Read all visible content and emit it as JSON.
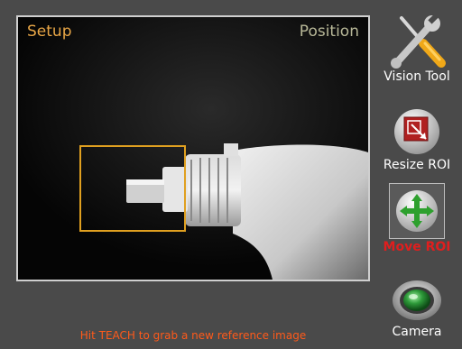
{
  "viewport": {
    "mode_label": "Setup",
    "tool_label": "Position"
  },
  "status": {
    "message": "Hit TEACH to grab a new reference image"
  },
  "tools": {
    "vision_tool": {
      "label": "Vision Tool",
      "icon": "tools-icon"
    },
    "resize_roi": {
      "label": "Resize ROI",
      "icon": "resize-icon"
    },
    "move_roi": {
      "label": "Move ROI",
      "icon": "move-icon",
      "active": true
    },
    "camera": {
      "label": "Camera",
      "icon": "camera-lens-icon"
    }
  },
  "colors": {
    "background": "#4a4a4a",
    "setup_label": "#e8a646",
    "position_label": "#b8b898",
    "roi_box": "#e0a020",
    "status_text": "#ff5a1a",
    "active_tool": "#e01e1e"
  }
}
